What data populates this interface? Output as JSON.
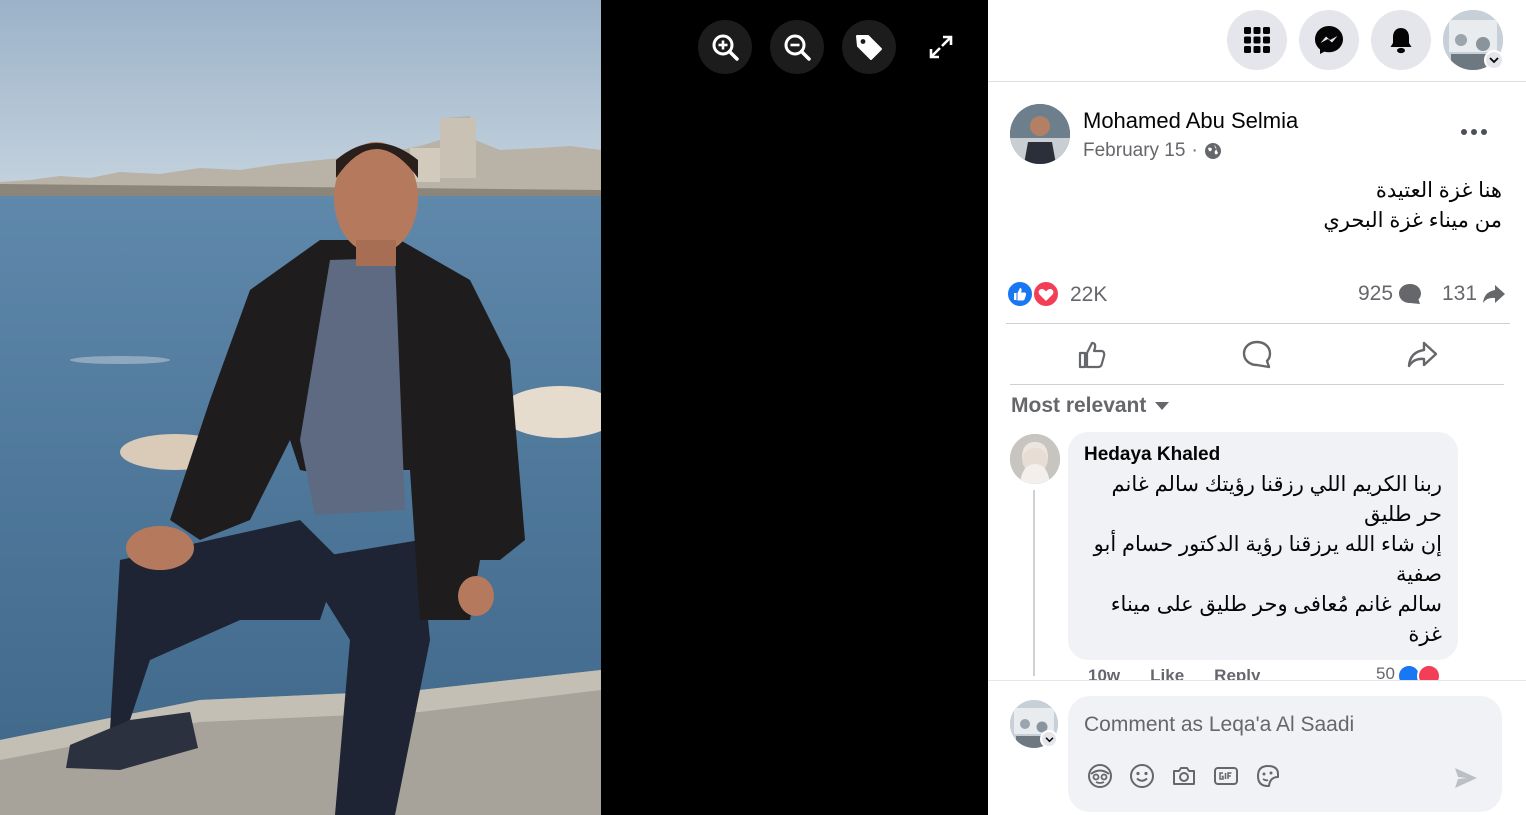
{
  "viewer": {
    "tools": [
      {
        "icon": "zoom-in-icon"
      },
      {
        "icon": "zoom-out-icon"
      },
      {
        "icon": "tag-icon"
      },
      {
        "icon": "fullscreen-icon"
      }
    ]
  },
  "topbar": {
    "icons": [
      "menu-grid-icon",
      "messenger-icon",
      "notifications-bell-icon",
      "account-avatar"
    ]
  },
  "post": {
    "author": "Mohamed Abu Selmia",
    "date": "February 15",
    "separator": "·",
    "privacy_icon": "globe-icon",
    "text_lines": [
      "هنا غزة العتيدة",
      "من ميناء غزة البحري"
    ],
    "reactions_count": "22K",
    "comments_count": "925",
    "shares_count": "131"
  },
  "sort": {
    "label": "Most relevant"
  },
  "comments": [
    {
      "author": "Hedaya Khaled",
      "text_lines": [
        "ربنا الكريم اللي رزقنا رؤيتك سالم غانم",
        "حر طليق",
        "إن شاء الله يرزقنا رؤية الدكتور حسام أبو",
        "صفية",
        "سالم غانم مُعافى وحر طليق على ميناء",
        "غزة"
      ],
      "time": "10w",
      "like": "Like",
      "reply": "Reply",
      "reactions": "50"
    }
  ],
  "composer": {
    "placeholder": "Comment as Leqa'a Al Saadi"
  },
  "colors": {
    "like_blue": "#1877f2",
    "love_red": "#f33e58",
    "secondary_text": "#65676b"
  }
}
